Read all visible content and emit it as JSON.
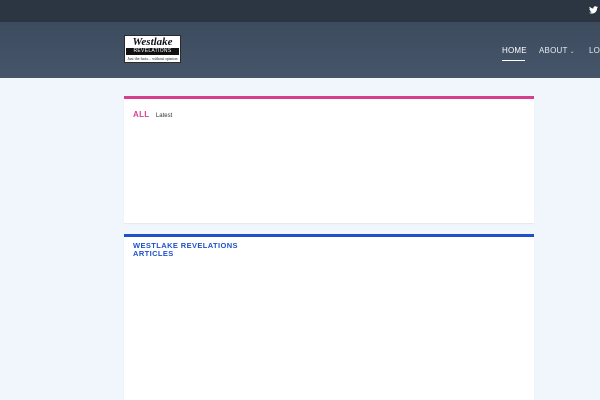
{
  "topbar": {
    "social_icon": "twitter-icon"
  },
  "header": {
    "logo": {
      "word": "Westlake",
      "band": "REVELATIONS",
      "tagline": "Just the facts... without opinion"
    },
    "nav": [
      {
        "label": "HOME",
        "active": true
      },
      {
        "label": "ABOUT",
        "has_dropdown": true
      },
      {
        "label": "LO"
      }
    ]
  },
  "sections": [
    {
      "title": "ALL",
      "subtitle": "Latest",
      "accent": "#d63f8c"
    },
    {
      "title_line1": "WESTLAKE REVELATIONS",
      "title_line2": "ARTICLES",
      "accent": "#1e51c9"
    }
  ],
  "colors": {
    "topbar": "#2c3643",
    "header": "#3f4e61",
    "page_bg": "#f1f6fd"
  }
}
